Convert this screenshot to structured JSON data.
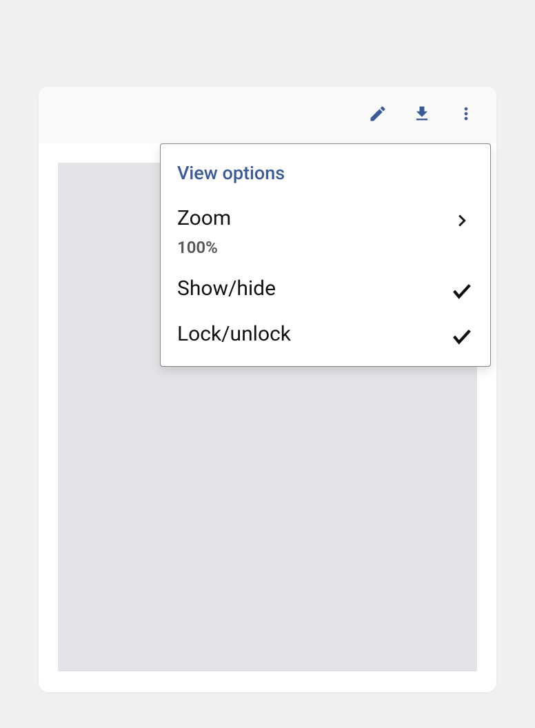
{
  "toolbar": {
    "icons": {
      "edit": "edit-icon",
      "download": "download-icon",
      "more": "more-vert-icon"
    }
  },
  "dropdown": {
    "header": "View options",
    "items": [
      {
        "label": "Zoom",
        "sublabel": "100%",
        "icon": "chevron-right-icon"
      },
      {
        "label": "Show/hide",
        "icon": "checkmark-icon"
      },
      {
        "label": "Lock/unlock",
        "icon": "checkmark-icon"
      }
    ]
  }
}
